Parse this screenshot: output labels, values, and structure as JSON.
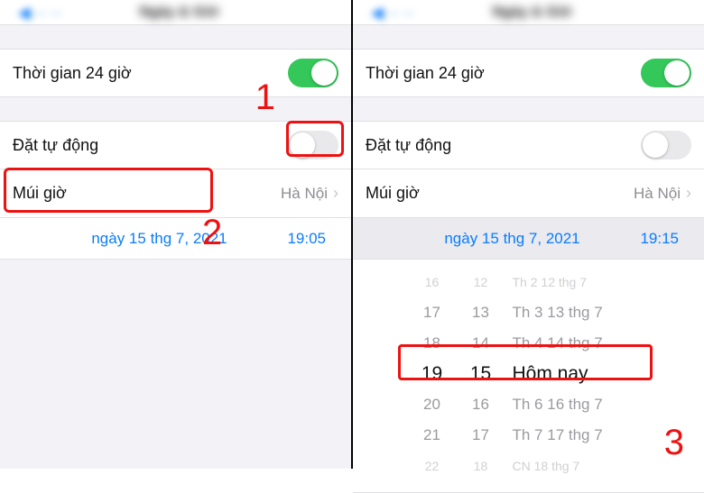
{
  "header": {
    "back_hint": "◀︎",
    "title_hint": "Ngày & Giờ"
  },
  "left": {
    "time24_label": "Thời gian 24 giờ",
    "autoset_label": "Đặt tự động",
    "timezone_label": "Múi giờ",
    "timezone_value": "Hà Nội",
    "date_text": "ngày 15 thg 7, 2021",
    "time_text": "19:05"
  },
  "right": {
    "time24_label": "Thời gian 24 giờ",
    "autoset_label": "Đặt tự động",
    "timezone_label": "Múi giờ",
    "timezone_value": "Hà Nội",
    "date_text": "ngày 15 thg 7, 2021",
    "time_text": "19:15",
    "picker": {
      "rows": [
        {
          "h": "16",
          "m": "12",
          "d": "Th 2 12 thg 7",
          "cls": "far"
        },
        {
          "h": "17",
          "m": "13",
          "d": "Th 3 13 thg 7",
          "cls": "near"
        },
        {
          "h": "18",
          "m": "14",
          "d": "Th 4 14 thg 7",
          "cls": "near"
        },
        {
          "h": "19",
          "m": "15",
          "d": "Hôm nay",
          "cls": "selected"
        },
        {
          "h": "20",
          "m": "16",
          "d": "Th 6 16 thg 7",
          "cls": "near"
        },
        {
          "h": "21",
          "m": "17",
          "d": "Th 7 17 thg 7",
          "cls": "near"
        },
        {
          "h": "22",
          "m": "18",
          "d": "CN 18 thg 7",
          "cls": "far"
        }
      ]
    }
  },
  "annotations": {
    "a1": "1",
    "a2": "2",
    "a3": "3"
  }
}
